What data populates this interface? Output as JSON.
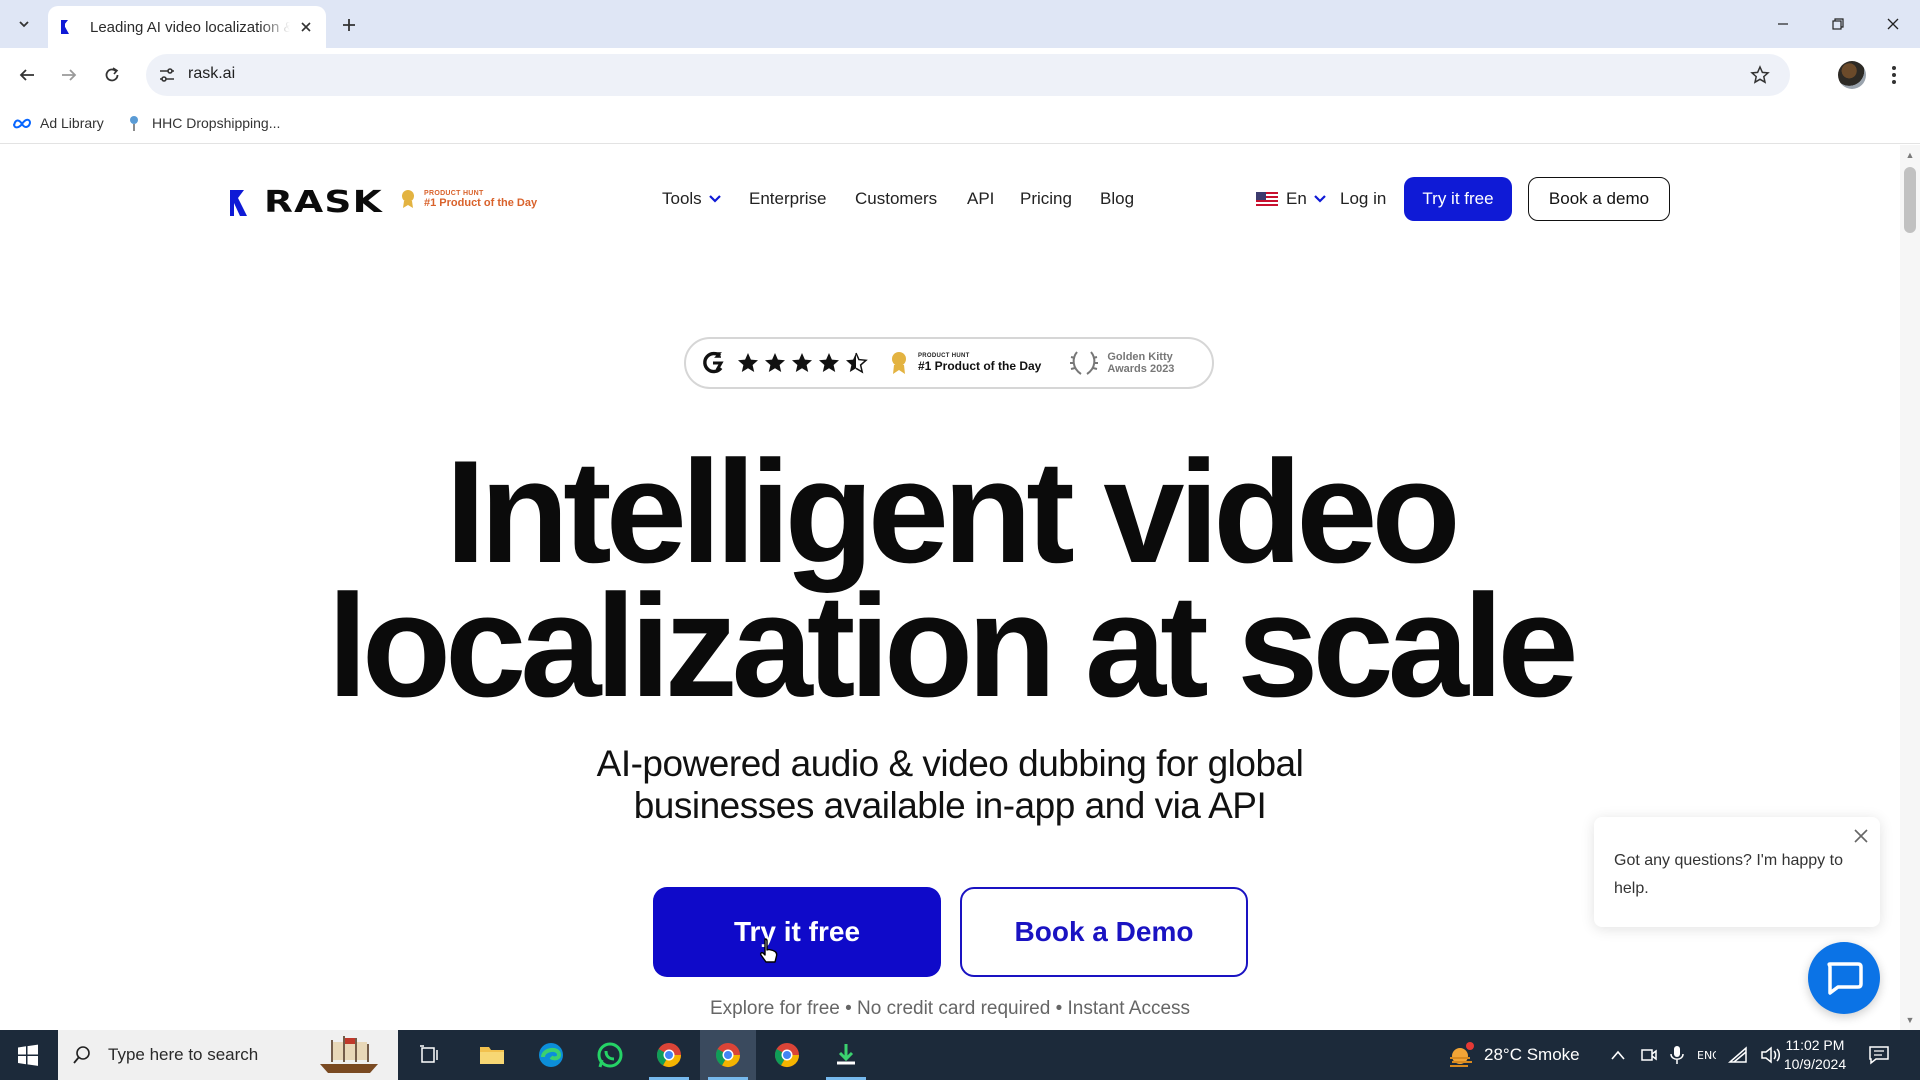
{
  "browser": {
    "tab_title": "Leading AI video localization &",
    "url": "rask.ai",
    "bookmarks": [
      {
        "label": "Ad Library",
        "icon": "meta-icon"
      },
      {
        "label": "HHC Dropshipping...",
        "icon": "pin-icon"
      }
    ]
  },
  "site": {
    "logo_text": "RASK",
    "ph_badge_small": "PRODUCT HUNT",
    "ph_badge_big": "#1 Product of the Day",
    "nav": [
      "Tools",
      "Enterprise",
      "Customers",
      "API",
      "Pricing",
      "Blog"
    ],
    "language": "En",
    "login": "Log in",
    "try_free": "Try it free",
    "book_demo": "Book a demo"
  },
  "awards": {
    "g2_rating": 4.5,
    "ph_small": "PRODUCT HUNT",
    "ph_big": "#1 Product of the Day",
    "kitty_line1": "Golden Kitty",
    "kitty_line2": "Awards 2023"
  },
  "hero": {
    "title_line1": "Intelligent video",
    "title_line2": "localization at scale",
    "subtitle_line1": "AI-powered audio & video dubbing for global",
    "subtitle_line2": "businesses available in-app and via API",
    "cta_primary": "Try it free",
    "cta_secondary": "Book a Demo",
    "fineprint": "Explore for free • No credit card required • Instant Access"
  },
  "chat": {
    "message": "Got any questions? I'm happy to help."
  },
  "taskbar": {
    "search_placeholder": "Type here to search",
    "weather": "28°C  Smoke",
    "time": "11:02 PM",
    "date": "10/9/2024"
  },
  "colors": {
    "brand_blue": "#0f0ac9",
    "tab_bar": "#dfe6f5",
    "taskbar": "#1c2a3a",
    "ph_orange": "#d9622b",
    "chat_blue": "#0b73e6"
  }
}
